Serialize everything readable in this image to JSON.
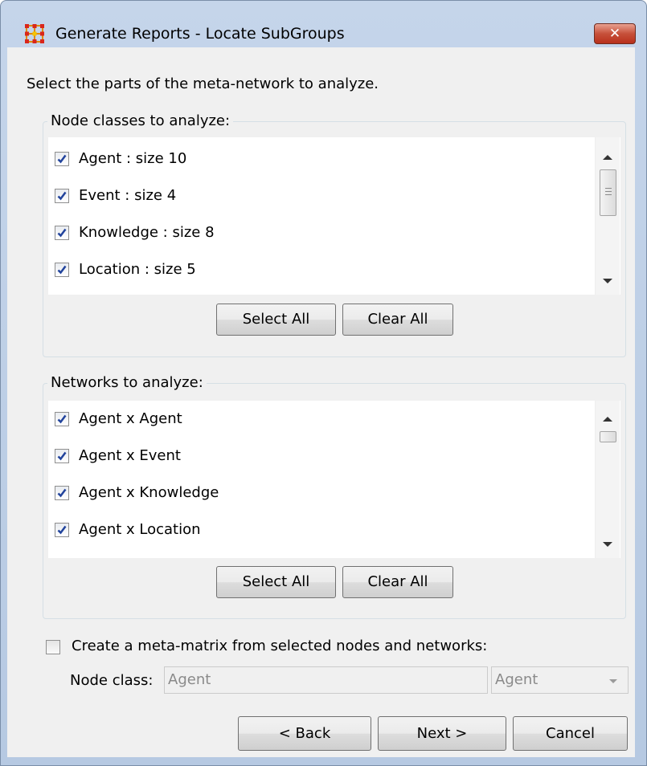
{
  "window": {
    "title": "Generate Reports - Locate SubGroups",
    "close_glyph": "✕"
  },
  "instructions": "Select the parts of the meta-network to analyze.",
  "node_classes": {
    "legend": "Node classes to analyze:",
    "items": [
      {
        "label": "Agent : size 10",
        "checked": true
      },
      {
        "label": "Event : size 4",
        "checked": true
      },
      {
        "label": "Knowledge : size 8",
        "checked": true
      },
      {
        "label": "Location : size 5",
        "checked": true
      }
    ],
    "select_all_label": "Select All",
    "clear_all_label": "Clear All"
  },
  "networks": {
    "legend": "Networks to analyze:",
    "items": [
      {
        "label": "Agent x Agent",
        "checked": true
      },
      {
        "label": "Agent x Event",
        "checked": true
      },
      {
        "label": "Agent x Knowledge",
        "checked": true
      },
      {
        "label": "Agent x Location",
        "checked": true
      }
    ],
    "select_all_label": "Select All",
    "clear_all_label": "Clear All"
  },
  "meta_matrix": {
    "checkbox_label": "Create a meta-matrix from selected nodes and networks:",
    "checked": false,
    "node_class_label": "Node class:",
    "node_class_value": "Agent",
    "combo_value": "Agent"
  },
  "footer": {
    "back_label": "< Back",
    "next_label": "Next >",
    "cancel_label": "Cancel"
  },
  "colors": {
    "title_bar": "#c5d5ea",
    "close_button": "#c7503a",
    "check_mark": "#21439c",
    "client_bg": "#f0f0f0"
  },
  "icons": {
    "app": "grid-network-icon",
    "close": "close-icon",
    "check": "check-icon"
  }
}
